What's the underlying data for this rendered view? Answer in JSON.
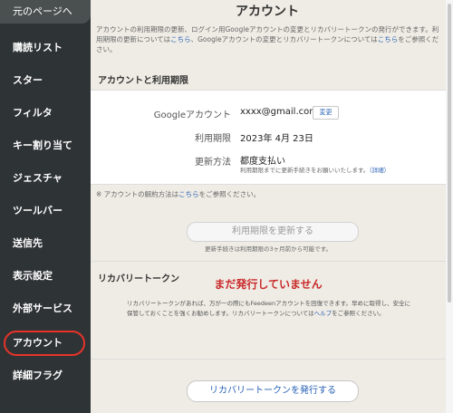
{
  "sidebar": {
    "back_label": "元のページへ",
    "items": [
      {
        "label": "購読リスト"
      },
      {
        "label": "スター"
      },
      {
        "label": "フィルタ"
      },
      {
        "label": "キー割り当て"
      },
      {
        "label": "ジェスチャ"
      },
      {
        "label": "ツールバー"
      },
      {
        "label": "送信先"
      },
      {
        "label": "表示設定"
      },
      {
        "label": "外部サービス"
      },
      {
        "label": "アカウント"
      },
      {
        "label": "詳細フラグ"
      }
    ],
    "active_index": 9
  },
  "main": {
    "title": "アカウント",
    "top_note": {
      "text1": "アカウントの利用期限の更新、ログイン用Googleアカウントの変更とリカバリートークンの発行ができます。利用期限の更新については",
      "link1": "こちら",
      "text2": "、Googleアカウントの変更とリカバリートークンについては",
      "link2": "こちら",
      "text3": "をご参照ください。"
    },
    "account_section": {
      "heading": "アカウントと利用期限",
      "google_label": "Googleアカウント",
      "google_value": "xxxx@gmail.com",
      "change_label": "変更",
      "expiry_label": "利用期限",
      "expiry_value": "2023年 4月 23日",
      "method_label": "更新方法",
      "method_value": "都度支払い",
      "method_note": "利用期限までに更新手続きをお願いいたします。",
      "method_detail_link": "（詳細）",
      "cancel_note_text1": "※ アカウントの解約方法は",
      "cancel_note_link": "こちら",
      "cancel_note_text2": "をご参照ください。",
      "renew_button": "利用期限を更新する",
      "renew_note": "更新手続きは利用期限の3ヶ月前から可能です。"
    },
    "recovery_section": {
      "heading": "リカバリートークン",
      "status": "まだ発行していません",
      "desc_text1": "リカバリートークンがあれば、万が一の際にもFeedeenアカウントを回復できます。早めに取得し、安全に保管しておくことを強くお勧めします。リカバリートークンについては",
      "desc_link": "ヘルプ",
      "desc_text2": "をご参照ください。",
      "issue_button": "リカバリートークンを発行する"
    }
  },
  "colors": {
    "sidebar_bg": "#2e3335",
    "highlight": "#e8332a",
    "link": "#2a62b5",
    "status_red": "#c9292a"
  }
}
